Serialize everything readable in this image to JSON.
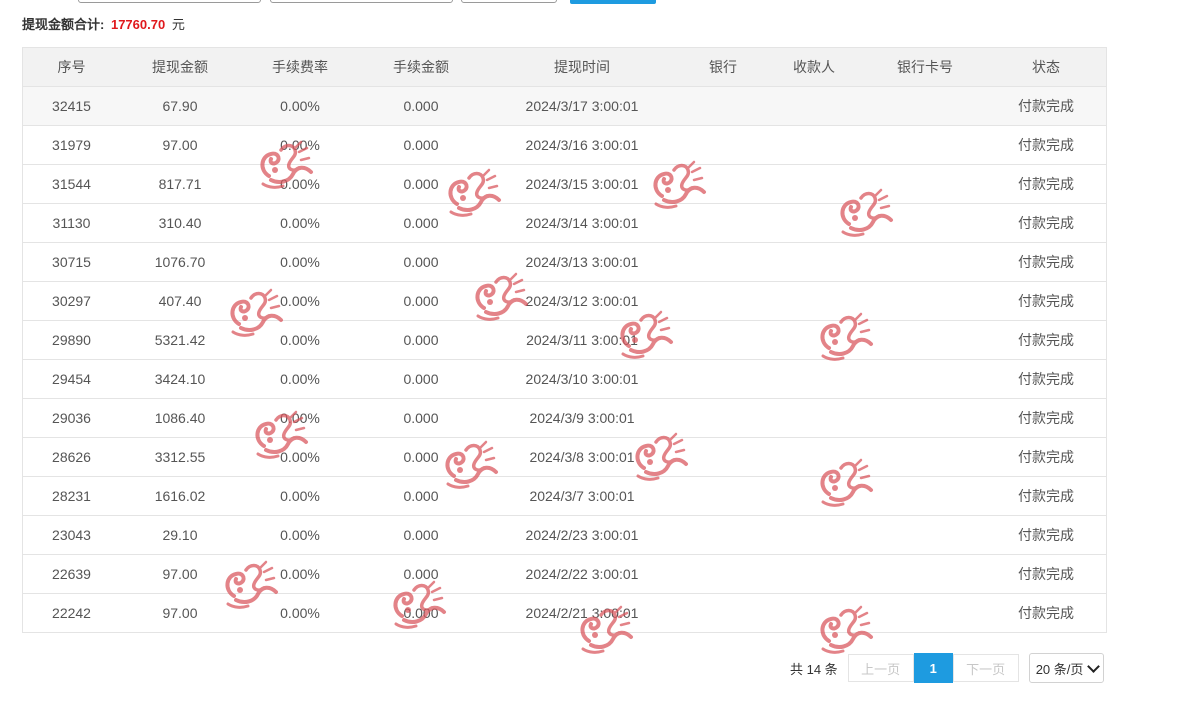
{
  "summary": {
    "label": "提现金额合计:",
    "amount": "17760.70",
    "unit": "元"
  },
  "table": {
    "columns": [
      "序号",
      "提现金额",
      "手续费率",
      "手续金额",
      "提现时间",
      "银行",
      "收款人",
      "银行卡号",
      "状态"
    ],
    "rows": [
      {
        "id": "32415",
        "amount": "67.90",
        "fee_rate": "0.00%",
        "fee": "0.000",
        "time": "2024/3/17 3:00:01",
        "bank": "",
        "payee": "",
        "card": "",
        "status": "付款完成"
      },
      {
        "id": "31979",
        "amount": "97.00",
        "fee_rate": "0.00%",
        "fee": "0.000",
        "time": "2024/3/16 3:00:01",
        "bank": "",
        "payee": "",
        "card": "",
        "status": "付款完成"
      },
      {
        "id": "31544",
        "amount": "817.71",
        "fee_rate": "0.00%",
        "fee": "0.000",
        "time": "2024/3/15 3:00:01",
        "bank": "",
        "payee": "",
        "card": "",
        "status": "付款完成"
      },
      {
        "id": "31130",
        "amount": "310.40",
        "fee_rate": "0.00%",
        "fee": "0.000",
        "time": "2024/3/14 3:00:01",
        "bank": "",
        "payee": "",
        "card": "",
        "status": "付款完成"
      },
      {
        "id": "30715",
        "amount": "1076.70",
        "fee_rate": "0.00%",
        "fee": "0.000",
        "time": "2024/3/13 3:00:01",
        "bank": "",
        "payee": "",
        "card": "",
        "status": "付款完成"
      },
      {
        "id": "30297",
        "amount": "407.40",
        "fee_rate": "0.00%",
        "fee": "0.000",
        "time": "2024/3/12 3:00:01",
        "bank": "",
        "payee": "",
        "card": "",
        "status": "付款完成"
      },
      {
        "id": "29890",
        "amount": "5321.42",
        "fee_rate": "0.00%",
        "fee": "0.000",
        "time": "2024/3/11 3:00:01",
        "bank": "",
        "payee": "",
        "card": "",
        "status": "付款完成"
      },
      {
        "id": "29454",
        "amount": "3424.10",
        "fee_rate": "0.00%",
        "fee": "0.000",
        "time": "2024/3/10 3:00:01",
        "bank": "",
        "payee": "",
        "card": "",
        "status": "付款完成"
      },
      {
        "id": "29036",
        "amount": "1086.40",
        "fee_rate": "0.00%",
        "fee": "0.000",
        "time": "2024/3/9 3:00:01",
        "bank": "",
        "payee": "",
        "card": "",
        "status": "付款完成"
      },
      {
        "id": "28626",
        "amount": "3312.55",
        "fee_rate": "0.00%",
        "fee": "0.000",
        "time": "2024/3/8 3:00:01",
        "bank": "",
        "payee": "",
        "card": "",
        "status": "付款完成"
      },
      {
        "id": "28231",
        "amount": "1616.02",
        "fee_rate": "0.00%",
        "fee": "0.000",
        "time": "2024/3/7 3:00:01",
        "bank": "",
        "payee": "",
        "card": "",
        "status": "付款完成"
      },
      {
        "id": "23043",
        "amount": "29.10",
        "fee_rate": "0.00%",
        "fee": "0.000",
        "time": "2024/2/23 3:00:01",
        "bank": "",
        "payee": "",
        "card": "",
        "status": "付款完成"
      },
      {
        "id": "22639",
        "amount": "97.00",
        "fee_rate": "0.00%",
        "fee": "0.000",
        "time": "2024/2/22 3:00:01",
        "bank": "",
        "payee": "",
        "card": "",
        "status": "付款完成"
      },
      {
        "id": "22242",
        "amount": "97.00",
        "fee_rate": "0.00%",
        "fee": "0.000",
        "time": "2024/2/21 3:00:01",
        "bank": "",
        "payee": "",
        "card": "",
        "status": "付款完成"
      }
    ]
  },
  "pagination": {
    "total_text": "共 14 条",
    "prev_label": "上一页",
    "current_page": "1",
    "next_label": "下一页",
    "page_size": "20 条/页"
  },
  "colors": {
    "accent": "#1e9be0",
    "total_amount": "#e0191d",
    "watermark": "#d9545b"
  },
  "icons": {
    "watermark": "dragon-watermark-icon",
    "page_size_toggle": "chevron-down-icon"
  }
}
